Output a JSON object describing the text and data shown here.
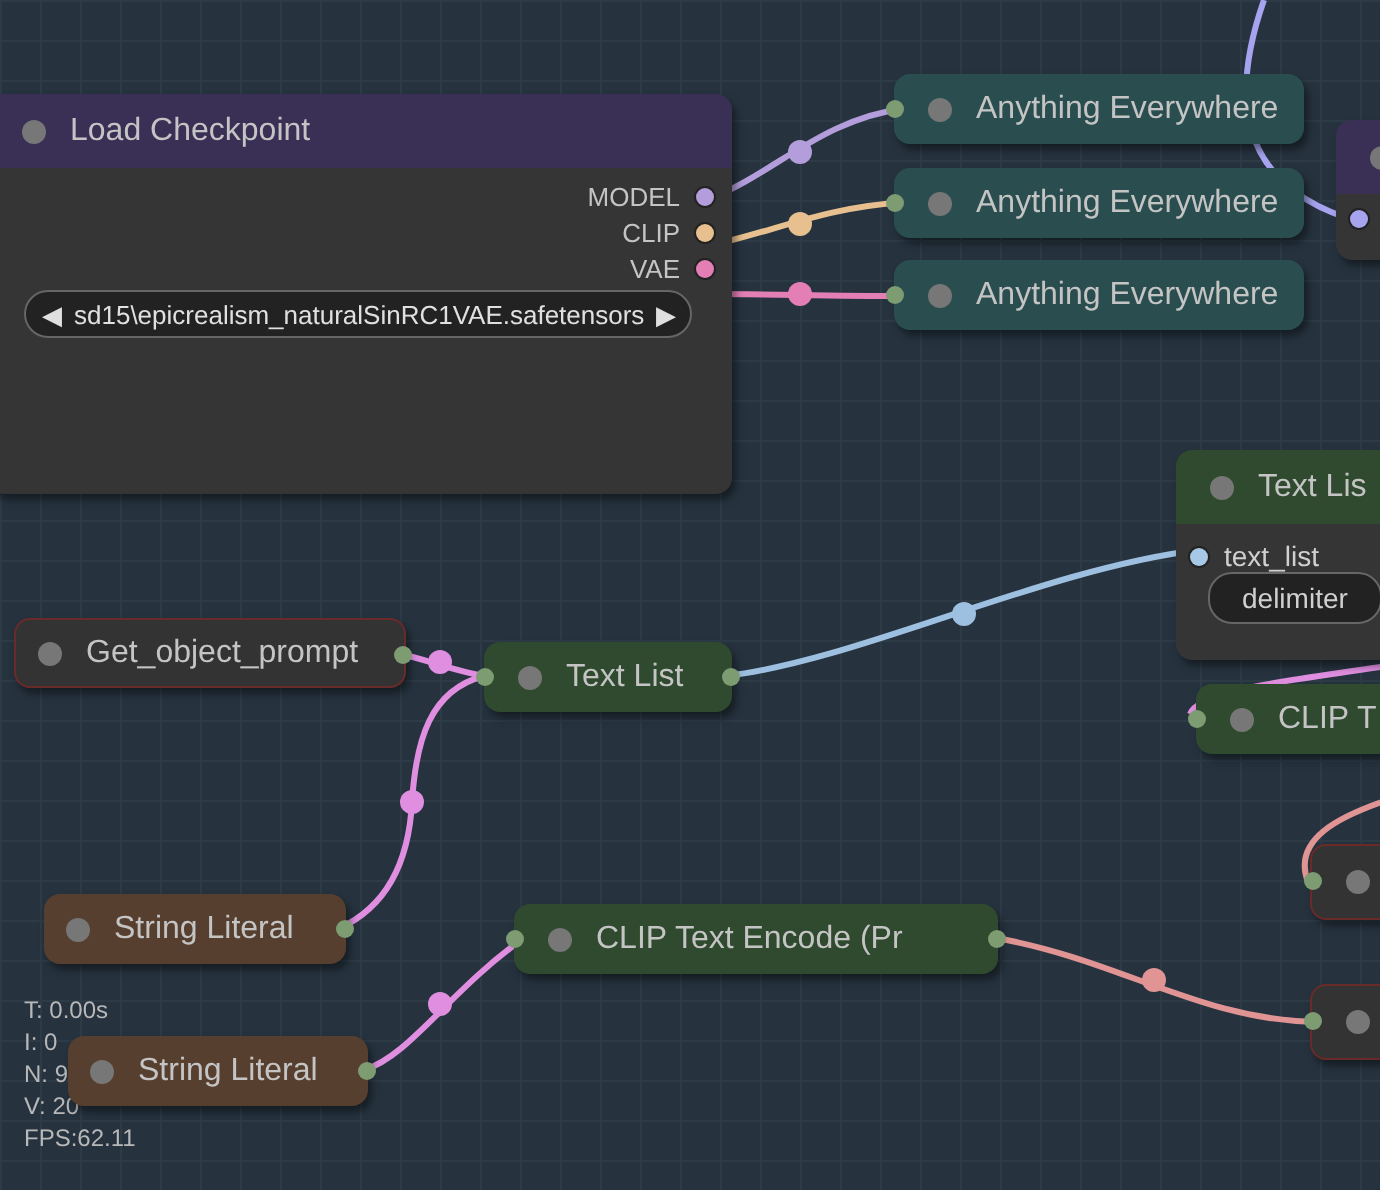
{
  "nodes": [
    {
      "kind": "full",
      "title": "Load Checkpoint",
      "color": "#3a2f55",
      "outputs": [
        {
          "label": "MODEL",
          "color": "#b39ddb"
        },
        {
          "label": "CLIP",
          "color": "#e8c08f"
        },
        {
          "label": "VAE",
          "color": "#e37fb5"
        }
      ],
      "widget": {
        "left": "◀",
        "value": "sd15\\epicrealism_naturalSinRC1VAE.safetensors",
        "right": "▶"
      }
    },
    {
      "kind": "collapsed",
      "title": "Anything Everywhere",
      "color": "#2a4e4f",
      "input": true,
      "output": false,
      "error": false
    },
    {
      "kind": "collapsed",
      "title": "Anything Everywhere",
      "color": "#2a4e4f",
      "input": true,
      "output": false,
      "error": false
    },
    {
      "kind": "collapsed",
      "title": "Anything Everywhere",
      "color": "#2a4e4f",
      "input": true,
      "output": false,
      "error": false
    },
    {
      "kind": "full",
      "color": "#3a2f55",
      "inputs": [
        {
          "color": "#a6a4ef"
        }
      ]
    },
    {
      "kind": "full",
      "title": "Text Lis",
      "color": "#2f4a2e",
      "inputs": [
        {
          "label": "text_list",
          "color": "#a8c8e8"
        }
      ],
      "widget": {
        "value": "delimiter"
      }
    },
    {
      "kind": "collapsed",
      "title": "CLIP T",
      "color": "#2f4a2e",
      "input": true,
      "output": false,
      "error": false
    },
    {
      "kind": "collapsed",
      "title": "Get_object_prompt",
      "color": "#333333",
      "input": false,
      "output": true,
      "error": true
    },
    {
      "kind": "collapsed",
      "title": "Text List",
      "color": "#2f4a2e",
      "input": true,
      "output": true,
      "error": false
    },
    {
      "kind": "collapsed",
      "title": "String Literal",
      "color": "#563f2f",
      "input": false,
      "output": true,
      "error": false
    },
    {
      "kind": "collapsed",
      "title": "CLIP Text Encode (Pr",
      "color": "#2f4a2e",
      "input": true,
      "output": true,
      "error": false
    },
    {
      "kind": "collapsed",
      "title": "String Literal",
      "color": "#563f2f",
      "input": false,
      "output": true,
      "error": false
    },
    {
      "kind": "collapsed",
      "color": "#333333",
      "input": true,
      "output": false,
      "error": true
    },
    {
      "kind": "collapsed",
      "color": "#333333",
      "input": true,
      "output": false,
      "error": true
    }
  ],
  "links": [
    {
      "color": "#b39ddb"
    },
    {
      "color": "#e8c08f"
    },
    {
      "color": "#e37fb5"
    },
    {
      "color": "#a6a4ef"
    },
    {
      "color": "#e08fe0"
    },
    {
      "color": "#e08fe0"
    },
    {
      "color": "#9ec0e0"
    },
    {
      "color": "#e08fe0"
    },
    {
      "color": "#e09494"
    },
    {
      "color": "#e08fe0"
    },
    {
      "color": "#e09494"
    }
  ],
  "stats": [
    "T: 0.00s",
    "I: 0",
    "N: 9",
    "V: 20",
    "FPS:62.11"
  ]
}
